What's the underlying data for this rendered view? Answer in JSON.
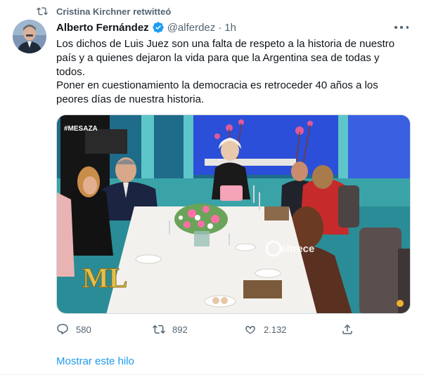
{
  "retweet": {
    "text": "Cristina Kirchner retwitteó"
  },
  "author": {
    "name": "Alberto Fernández",
    "handle": "@alferdez",
    "separator": "·",
    "time": "1h"
  },
  "tweet": {
    "paragraph1": "Los dichos de Luis Juez son una falta de respeto a la historia de nuestro país y a quienes dejaron la vida para que la Argentina sea de todas y todos.",
    "paragraph2": "Poner en cuestionamiento la democracia es retroceder 40 años a los peores días de nuestra historia."
  },
  "media": {
    "tag": "#MESAZA",
    "logo": "ML",
    "channel": "eltrece"
  },
  "actions": {
    "replies": "580",
    "retweets": "892",
    "likes": "2.132"
  },
  "show_thread": "Mostrar este hilo",
  "colors": {
    "accent": "#1d9bf0",
    "secondary_text": "#536471",
    "verified": "#1d9bf0"
  }
}
